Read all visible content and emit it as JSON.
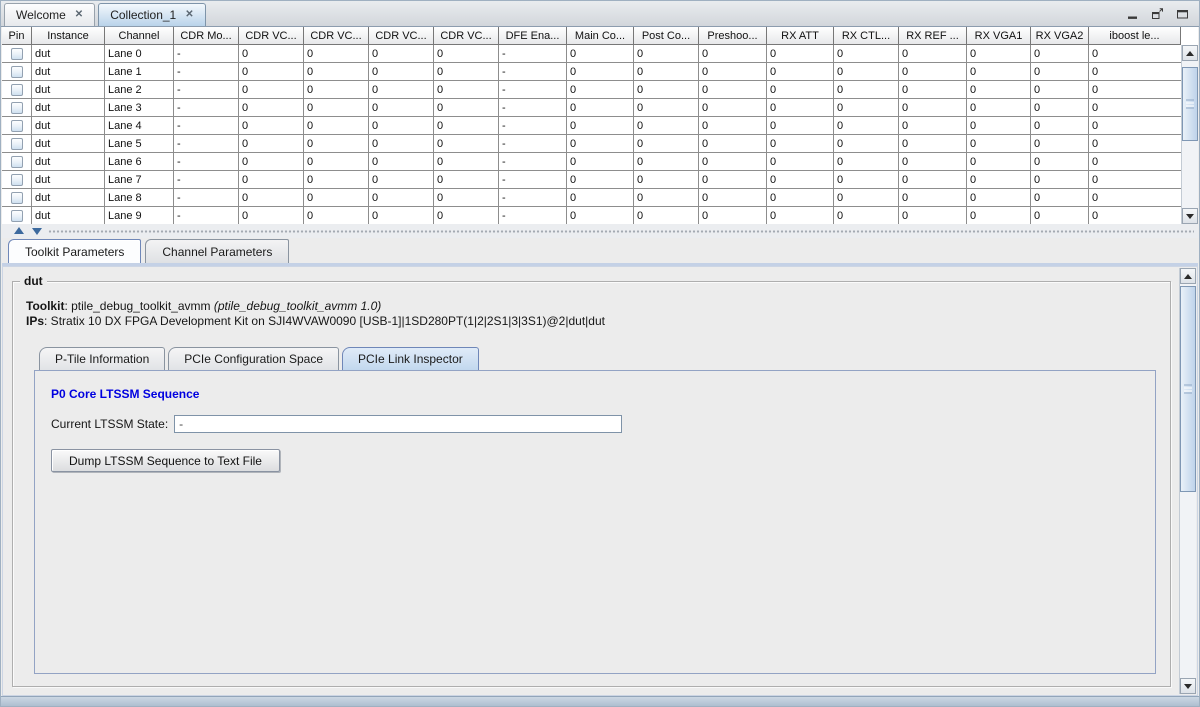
{
  "editor_tabs": [
    {
      "label": "Welcome",
      "selected": false
    },
    {
      "label": "Collection_1",
      "selected": true
    }
  ],
  "icons": {
    "close": "✕"
  },
  "table": {
    "columns": [
      "Pin",
      "Instance",
      "Channel",
      "CDR Mo...",
      "CDR VC...",
      "CDR VC...",
      "CDR VC...",
      "CDR VC...",
      "DFE Ena...",
      "Main Co...",
      "Post Co...",
      "Preshoo...",
      "RX ATT",
      "RX CTL...",
      "RX REF ...",
      "RX VGA1",
      "RX VGA2",
      "iboost le..."
    ],
    "rows": [
      {
        "pin": false,
        "instance": "dut",
        "channel": "Lane 0",
        "values": [
          "-",
          "0",
          "0",
          "0",
          "0",
          "-",
          "0",
          "0",
          "0",
          "0",
          "0",
          "0",
          "0",
          "0",
          "0"
        ]
      },
      {
        "pin": false,
        "instance": "dut",
        "channel": "Lane 1",
        "values": [
          "-",
          "0",
          "0",
          "0",
          "0",
          "-",
          "0",
          "0",
          "0",
          "0",
          "0",
          "0",
          "0",
          "0",
          "0"
        ]
      },
      {
        "pin": false,
        "instance": "dut",
        "channel": "Lane 2",
        "values": [
          "-",
          "0",
          "0",
          "0",
          "0",
          "-",
          "0",
          "0",
          "0",
          "0",
          "0",
          "0",
          "0",
          "0",
          "0"
        ]
      },
      {
        "pin": false,
        "instance": "dut",
        "channel": "Lane 3",
        "values": [
          "-",
          "0",
          "0",
          "0",
          "0",
          "-",
          "0",
          "0",
          "0",
          "0",
          "0",
          "0",
          "0",
          "0",
          "0"
        ]
      },
      {
        "pin": false,
        "instance": "dut",
        "channel": "Lane 4",
        "values": [
          "-",
          "0",
          "0",
          "0",
          "0",
          "-",
          "0",
          "0",
          "0",
          "0",
          "0",
          "0",
          "0",
          "0",
          "0"
        ]
      },
      {
        "pin": false,
        "instance": "dut",
        "channel": "Lane 5",
        "values": [
          "-",
          "0",
          "0",
          "0",
          "0",
          "-",
          "0",
          "0",
          "0",
          "0",
          "0",
          "0",
          "0",
          "0",
          "0"
        ]
      },
      {
        "pin": false,
        "instance": "dut",
        "channel": "Lane 6",
        "values": [
          "-",
          "0",
          "0",
          "0",
          "0",
          "-",
          "0",
          "0",
          "0",
          "0",
          "0",
          "0",
          "0",
          "0",
          "0"
        ]
      },
      {
        "pin": false,
        "instance": "dut",
        "channel": "Lane 7",
        "values": [
          "-",
          "0",
          "0",
          "0",
          "0",
          "-",
          "0",
          "0",
          "0",
          "0",
          "0",
          "0",
          "0",
          "0",
          "0"
        ]
      },
      {
        "pin": false,
        "instance": "dut",
        "channel": "Lane 8",
        "values": [
          "-",
          "0",
          "0",
          "0",
          "0",
          "-",
          "0",
          "0",
          "0",
          "0",
          "0",
          "0",
          "0",
          "0",
          "0"
        ]
      },
      {
        "pin": false,
        "instance": "dut",
        "channel": "Lane 9",
        "values": [
          "-",
          "0",
          "0",
          "0",
          "0",
          "-",
          "0",
          "0",
          "0",
          "0",
          "0",
          "0",
          "0",
          "0",
          "0"
        ]
      }
    ]
  },
  "bottom_tabs": [
    {
      "label": "Toolkit Parameters",
      "selected": true
    },
    {
      "label": "Channel Parameters",
      "selected": false
    }
  ],
  "dut_group": {
    "title": "dut",
    "toolkit_label": "Toolkit",
    "toolkit_text": ": ptile_debug_toolkit_avmm ",
    "toolkit_version": "(ptile_debug_toolkit_avmm 1.0)",
    "ips_label": "IPs",
    "ips_text": ": Stratix 10 DX FPGA Development Kit on SJI4WVAW0090 [USB-1]|1SD280PT(1|2|2S1|3|3S1)@2|dut|dut"
  },
  "inner_tabs": [
    {
      "label": "P-Tile Information",
      "selected": false
    },
    {
      "label": "PCIe Configuration Space",
      "selected": false
    },
    {
      "label": "PCIe Link Inspector",
      "selected": true
    }
  ],
  "link_inspector": {
    "heading": "P0 Core LTSSM Sequence",
    "state_label": "Current LTSSM State:",
    "state_value": "-",
    "dump_button_label": "Dump LTSSM Sequence to Text File"
  },
  "colors": {
    "heading_blue": "#0000e0",
    "selected_tab_blue": "#c2d8ee",
    "splitter_arrow_blue": "#3d6a9e"
  }
}
